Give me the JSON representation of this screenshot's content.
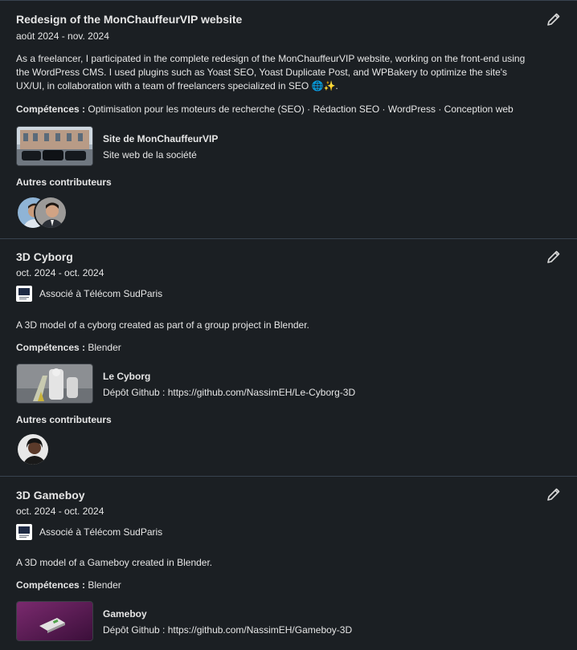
{
  "projects": [
    {
      "title": "Redesign of the MonChauffeurVIP website",
      "dates": "août 2024 - nov. 2024",
      "description": "As a freelancer, I participated in the complete redesign of the MonChauffeurVIP website, working on the front-end using the WordPress CMS. I used plugins such as Yoast SEO, Yoast Duplicate Post, and WPBakery to optimize the site's UX/UI, in collaboration with a team of freelancers specialized in SEO 🌐✨.",
      "skills_label": "Compétences :",
      "skills": "Optimisation pour les moteurs de recherche (SEO) · Rédaction SEO · WordPress · Conception web",
      "media_title": "Site de MonChauffeurVIP",
      "media_subtitle": "Site web de la société",
      "contributors_label": "Autres contributeurs"
    },
    {
      "title": "3D Cyborg",
      "dates": "oct. 2024 - oct. 2024",
      "association": "Associé à Télécom SudParis",
      "description": "A 3D model of a cyborg created as part of a group project in Blender.",
      "skills_label": "Compétences :",
      "skills": "Blender",
      "media_title": "Le Cyborg",
      "media_subtitle": "Dépôt Github : https://github.com/NassimEH/Le-Cyborg-3D",
      "contributors_label": "Autres contributeurs"
    },
    {
      "title": "3D Gameboy",
      "dates": "oct. 2024 - oct. 2024",
      "association": "Associé à Télécom SudParis",
      "description": "A 3D model of a Gameboy created in Blender.",
      "skills_label": "Compétences :",
      "skills": "Blender",
      "media_title": "Gameboy",
      "media_subtitle": "Dépôt Github : https://github.com/NassimEH/Gameboy-3D"
    }
  ],
  "colors": {
    "background": "#1b1f23",
    "divider": "#38434f",
    "text": "#e6e6e6"
  },
  "icons": {
    "edit": "pencil-icon"
  }
}
